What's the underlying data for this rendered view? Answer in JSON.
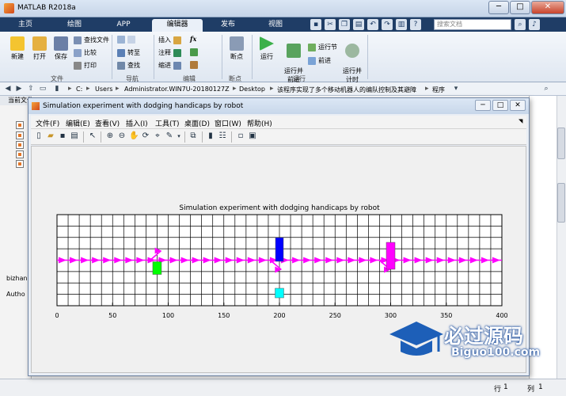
{
  "window": {
    "title": "MATLAB R2018a",
    "minimize": "─",
    "maximize": "□",
    "close": "✕"
  },
  "ribbon": {
    "tabs": [
      {
        "label": "主页"
      },
      {
        "label": "绘图"
      },
      {
        "label": "APP"
      },
      {
        "label": "编辑器"
      },
      {
        "label": "发布"
      },
      {
        "label": "视图"
      }
    ],
    "active_tab": "编辑器",
    "search_placeholder": "搜索文档",
    "file_group": {
      "label": "文件",
      "new": "新建",
      "open": "打开",
      "save": "保存",
      "find_files": "查找文件",
      "compare": "比较",
      "print": "打印"
    },
    "nav_group": {
      "label": "导航",
      "goto": "转至",
      "find": "查找"
    },
    "edit_group": {
      "label": "编辑",
      "insert": "插入",
      "comment": "注释",
      "indent": "缩进",
      "fx": "fx"
    },
    "breakpoints_group": {
      "label": "断点",
      "breakpoints": "断点"
    },
    "run_group": {
      "label": "运行",
      "run": "运行",
      "run_advance": "运行并\n前进",
      "run_section": "运行节",
      "advance": "前进",
      "run_time": "运行并\n计时"
    }
  },
  "address": {
    "crumbs": [
      "C:",
      "Users",
      "Administrator.WIN7U-20180127Z",
      "Desktop",
      "该程序实现了多个移动机器人的编队控制及其避障",
      "程序"
    ]
  },
  "left_panel": {
    "header": "当前文件夹",
    "label_a": "bizhan",
    "label_b": "Autho"
  },
  "status": {
    "row_label": "行",
    "row_value": "1",
    "col_label": "列",
    "col_value": "1"
  },
  "figure": {
    "title": "Simulation experiment with dodging handicaps by robot",
    "menus": [
      "文件(F)",
      "编辑(E)",
      "查看(V)",
      "插入(I)",
      "工具(T)",
      "桌面(D)",
      "窗口(W)",
      "帮助(H)"
    ],
    "winbtns": {
      "min": "─",
      "max": "□",
      "close": "✕"
    }
  },
  "chart_data": {
    "type": "scatter",
    "title": "Simulation experiment with dodging handicaps by robot",
    "xlim": [
      0,
      400
    ],
    "x_ticks": [
      0,
      50,
      100,
      150,
      200,
      250,
      300,
      350,
      400
    ],
    "grid": true,
    "arrow_color": "#ff00ff",
    "obstacles": [
      {
        "name": "green",
        "x": 90,
        "color": "#00ff00"
      },
      {
        "name": "blue",
        "x": 200,
        "color": "#0000ff"
      },
      {
        "name": "magenta",
        "x": 300,
        "color": "#ff00ff"
      },
      {
        "name": "cyan",
        "x": 200,
        "color": "#00ffff"
      }
    ]
  },
  "watermark": {
    "text": "必过源码",
    "url": "Biguo100.com"
  }
}
